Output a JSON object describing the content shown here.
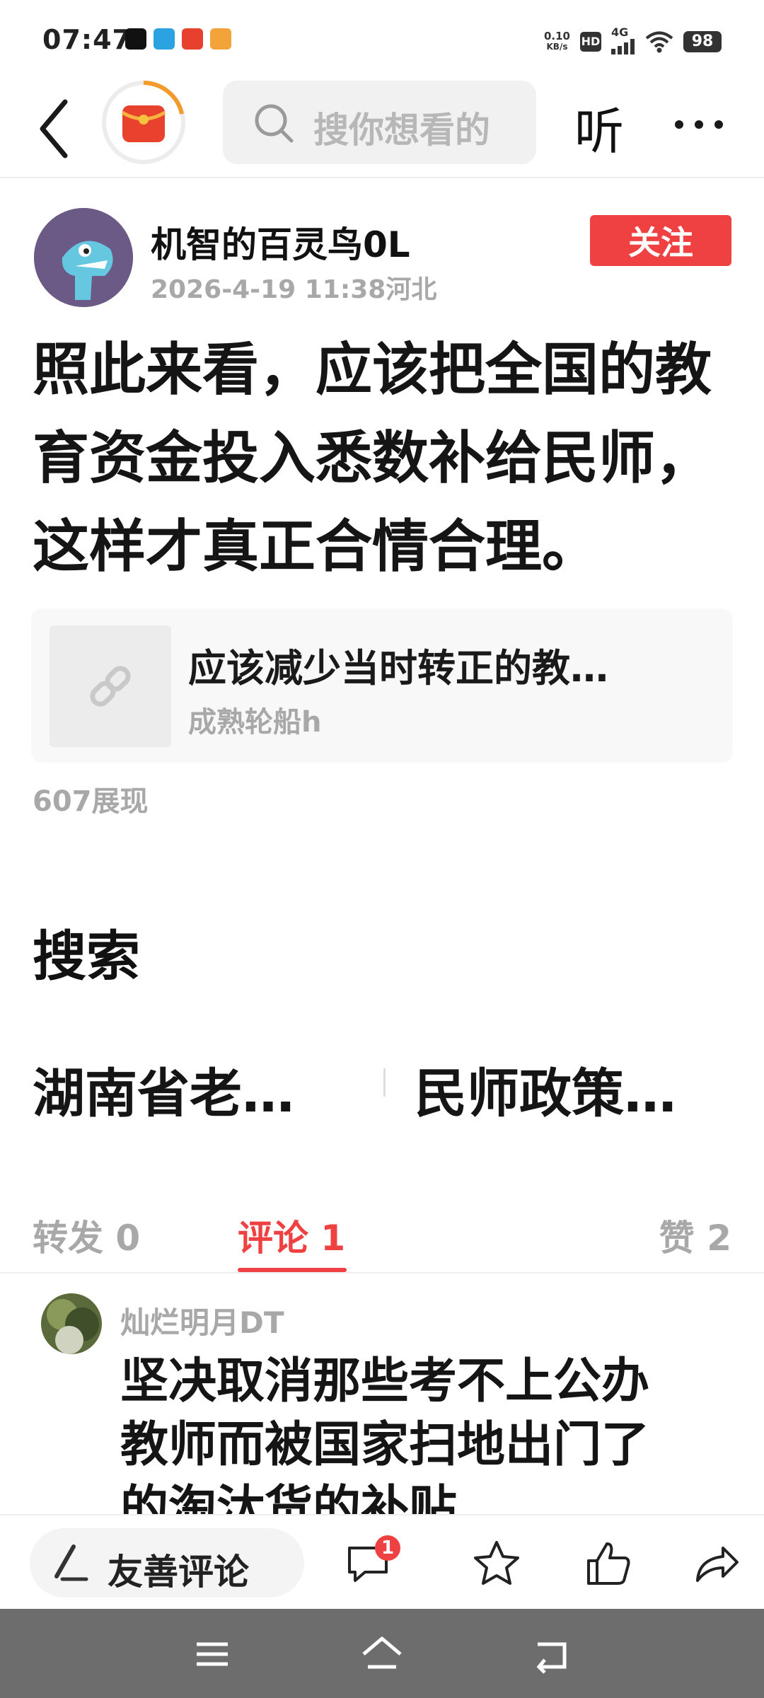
{
  "status_bar": {
    "time": "07:47",
    "net_speed_value": "0.10",
    "net_speed_unit": "KB/s",
    "hd": "HD",
    "network": "4G",
    "battery": "98",
    "app_icons": [
      "douyin-icon",
      "telegram-icon",
      "toutiao-icon",
      "video-app-icon"
    ],
    "app_icon_colors": [
      "#111111",
      "#2aa3e0",
      "#e8402f",
      "#f2a33a"
    ]
  },
  "top_nav": {
    "search_placeholder": "搜你想看的",
    "listen_label": "听",
    "accent": "#f04142"
  },
  "post": {
    "author": "机智的百灵鸟0L",
    "meta": "2026-4-19 11:38河北",
    "follow_label": "关注",
    "text": "照此来看，应该把全国的教育资金投入悉数补给民师，这样才真正合情合理。",
    "quote": {
      "title": "应该减少当时转正的教…",
      "author": "成熟轮船h"
    },
    "views": "607展现"
  },
  "search_section": {
    "title": "搜索",
    "suggestions": [
      "湖南省老…",
      "民师政策…"
    ]
  },
  "tabs": {
    "forward": "转发 0",
    "comment": "评论 1",
    "like": "赞 2"
  },
  "comment": {
    "author": "灿烂明月DT",
    "text": "坚决取消那些考不上公办教师而被国家扫地出门了的淘汰货的补贴"
  },
  "action_bar": {
    "comment_input_label": "友善评论",
    "comment_badge": "1"
  }
}
